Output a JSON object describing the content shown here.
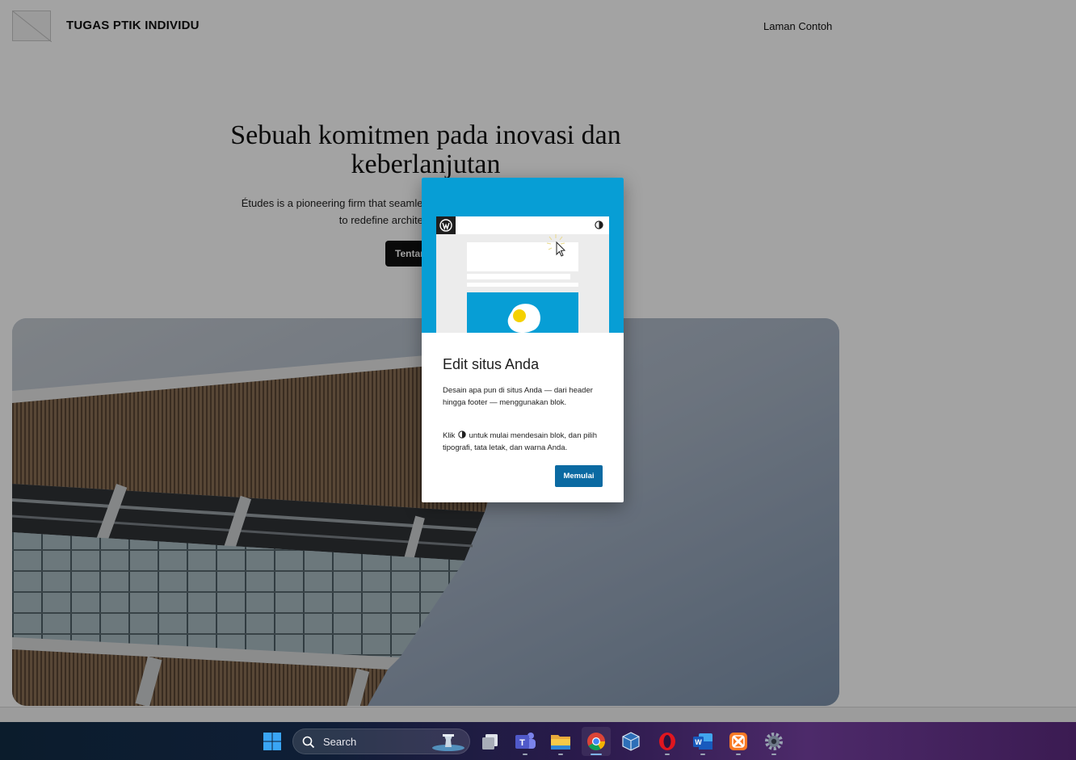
{
  "site": {
    "title": "TUGAS PTIK INDIVIDU",
    "nav_link": "Laman Contoh",
    "hero": {
      "heading": "Sebuah komitmen pada inovasi dan keberlanjutan",
      "text": "Études is a pioneering firm that seamlessly merges creativity and functionality to redefine architectural excellence.",
      "button_label": "Tentang kami"
    }
  },
  "modal": {
    "title": "Edit situs Anda",
    "paragraph1": "Desain apa pun di situs Anda — dari header hingga footer — menggunakan blok.",
    "paragraph2_before": "Klik",
    "paragraph2_after": "untuk mulai mendesain blok, dan pilih tipografi, tata letak, dan warna Anda.",
    "button_label": "Memulai",
    "accent_color": "#079ed5",
    "button_color": "#0b6aa2"
  },
  "taskbar": {
    "search_placeholder": "Search",
    "apps": [
      {
        "icon": "windows-start-icon"
      },
      {
        "icon": "task-view-icon"
      },
      {
        "icon": "teams-icon"
      },
      {
        "icon": "file-explorer-icon"
      },
      {
        "icon": "chrome-icon",
        "active": true
      },
      {
        "icon": "virtualbox-icon"
      },
      {
        "icon": "opera-icon"
      },
      {
        "icon": "word-icon"
      },
      {
        "icon": "xampp-icon"
      },
      {
        "icon": "settings-gear-icon"
      }
    ]
  }
}
